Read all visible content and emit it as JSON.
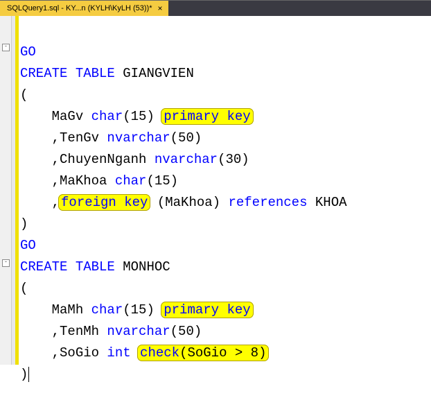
{
  "tab": {
    "title": "SQLQuery1.sql - KY...n (KYLH\\KyLH (53))*",
    "close": "×"
  },
  "code": {
    "l1_go": "GO",
    "l2_create": "CREATE",
    "l2_table": "TABLE",
    "l2_name": " GIANGVIEN",
    "l3": "(",
    "l4_col": "    MaGv ",
    "l4_type": "char",
    "l4_paren": "(15) ",
    "l4_pk": "primary key",
    "l5_pre": "    ,TenGv ",
    "l5_type": "nvarchar",
    "l5_post": "(50)",
    "l6_pre": "    ,ChuyenNganh ",
    "l6_type": "nvarchar",
    "l6_post": "(30)",
    "l7_pre": "    ,MaKhoa ",
    "l7_type": "char",
    "l7_post": "(15)",
    "l8_pre": "    ,",
    "l8_fk": "foreign key",
    "l8_mid": " (MaKhoa) ",
    "l8_ref": "references",
    "l8_post": " KHOA",
    "l9": ")",
    "l10_go": "GO",
    "l11_create": "CREATE",
    "l11_table": "TABLE",
    "l11_name": " MONHOC",
    "l12": "(",
    "l13_col": "    MaMh ",
    "l13_type": "char",
    "l13_paren": "(15) ",
    "l13_pk": "primary key",
    "l14_pre": "    ,TenMh ",
    "l14_type": "nvarchar",
    "l14_post": "(50)",
    "l15_pre": "    ,SoGio ",
    "l15_type": "int",
    "l15_sp": " ",
    "l15_chk1": "check",
    "l15_chk2": "(SoGio > 8)",
    "l16": ")"
  }
}
